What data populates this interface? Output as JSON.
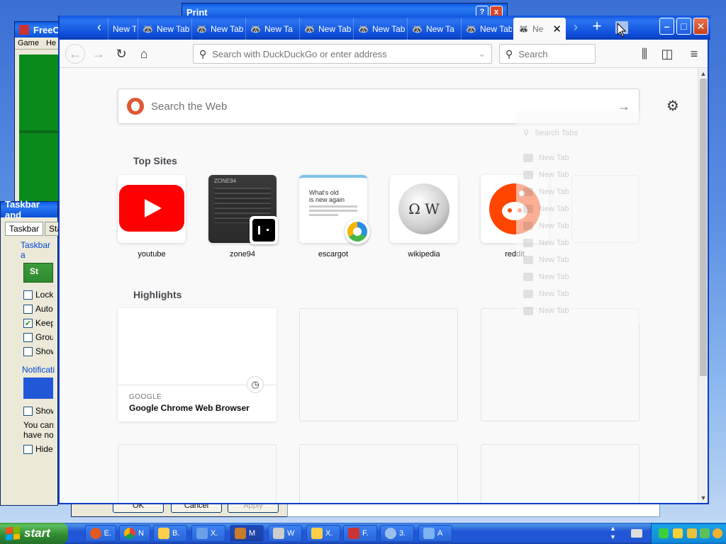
{
  "background": {
    "freecell_title": "FreeC",
    "freecell_menu": [
      "Game",
      "He"
    ],
    "print_title": "Print",
    "print_help": "?",
    "print_close": "x",
    "taskbar_props": {
      "title": "Taskbar and",
      "tabs": [
        "Taskbar",
        "Sta"
      ],
      "group1": "Taskbar a",
      "start_label": "St",
      "checks": [
        {
          "label": "Lock t",
          "checked": false
        },
        {
          "label": "Auto-h",
          "checked": false
        },
        {
          "label": "Keep t",
          "checked": true
        },
        {
          "label": "Group",
          "checked": false
        },
        {
          "label": "Show",
          "checked": false
        }
      ],
      "group2": "Notificati",
      "show_check": "Show",
      "text_line1": "You can k",
      "text_line2": "have not c",
      "hide_check": "Hide in"
    },
    "dialog_buttons": [
      "OK",
      "Cancel",
      "Apply"
    ]
  },
  "firefox": {
    "tabs": [
      {
        "label": "New Ta"
      },
      {
        "label": "New Tab"
      },
      {
        "label": "New Tab"
      },
      {
        "label": "New Ta"
      },
      {
        "label": "New Tab"
      },
      {
        "label": "New Tab"
      },
      {
        "label": "New Ta"
      },
      {
        "label": "New Tab"
      }
    ],
    "active_tab": {
      "label": "Ne",
      "close": "✕"
    },
    "new_tab": "+",
    "address_placeholder": "Search with DuckDuckGo or enter address",
    "search_placeholder": "Search",
    "web_search_placeholder": "Search the Web",
    "top_sites_title": "Top Sites",
    "top_sites": [
      {
        "label": "youtube"
      },
      {
        "label": "zone94",
        "preview_title": "ZONE94"
      },
      {
        "label": "escargot",
        "preview_line1": "What's old",
        "preview_line2": "is new again"
      },
      {
        "label": "wikipedia"
      },
      {
        "label": "reddit"
      },
      {
        "label": ""
      }
    ],
    "highlights_title": "Highlights",
    "highlights": [
      {
        "source": "GOOGLE",
        "title": "Google Chrome Web Browser"
      }
    ],
    "tab_list_ghost": [
      "Search Tabs",
      "New Tab",
      "New Tab",
      "New Tab",
      "New Tab",
      "New Tab",
      "New Tab",
      "New Tab",
      "New Tab",
      "New Tab",
      "New Tab"
    ]
  },
  "taskbar": {
    "start": "start",
    "tasks": [
      {
        "label": "E."
      },
      {
        "label": "N"
      },
      {
        "label": "B."
      },
      {
        "label": "X."
      },
      {
        "label": "M"
      },
      {
        "label": "W"
      },
      {
        "label": "X."
      },
      {
        "label": "F."
      },
      {
        "label": "3."
      },
      {
        "label": "A"
      }
    ]
  }
}
